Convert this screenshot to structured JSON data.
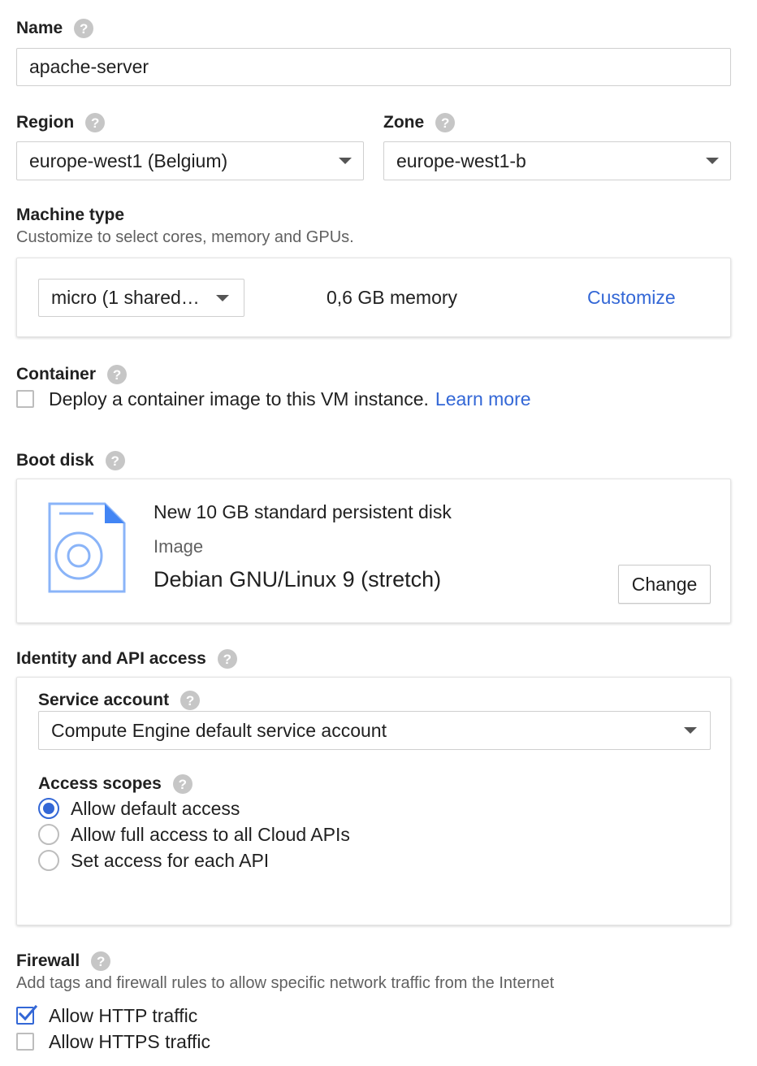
{
  "name": {
    "label": "Name",
    "value": "apache-server"
  },
  "region": {
    "label": "Region",
    "value": "europe-west1 (Belgium)"
  },
  "zone": {
    "label": "Zone",
    "value": "europe-west1-b"
  },
  "machine_type": {
    "label": "Machine type",
    "description": "Customize to select cores, memory and GPUs.",
    "selected": "micro (1 shared…",
    "memory": "0,6 GB memory",
    "customize_link": "Customize"
  },
  "container": {
    "label": "Container",
    "checkbox_label": "Deploy a container image to this VM instance.",
    "checked": false,
    "learn_more": "Learn more"
  },
  "boot_disk": {
    "label": "Boot disk",
    "disk_title": "New 10 GB standard persistent disk",
    "image_label": "Image",
    "image_value": "Debian GNU/Linux 9 (stretch)",
    "change_button": "Change"
  },
  "identity": {
    "label": "Identity and API access",
    "service_account_label": "Service account",
    "service_account_value": "Compute Engine default service account",
    "access_scopes_label": "Access scopes",
    "options": [
      {
        "label": "Allow default access",
        "selected": true
      },
      {
        "label": "Allow full access to all Cloud APIs",
        "selected": false
      },
      {
        "label": "Set access for each API",
        "selected": false
      }
    ]
  },
  "firewall": {
    "label": "Firewall",
    "description": "Add tags and firewall rules to allow specific network traffic from the Internet",
    "options": [
      {
        "label": "Allow HTTP traffic",
        "checked": true
      },
      {
        "label": "Allow HTTPS traffic",
        "checked": false
      }
    ]
  },
  "help_glyph": "?",
  "colors": {
    "accent": "#3367d6",
    "help_icon": "#c6c6c6",
    "text": "#212121",
    "secondary_text": "#616161"
  }
}
